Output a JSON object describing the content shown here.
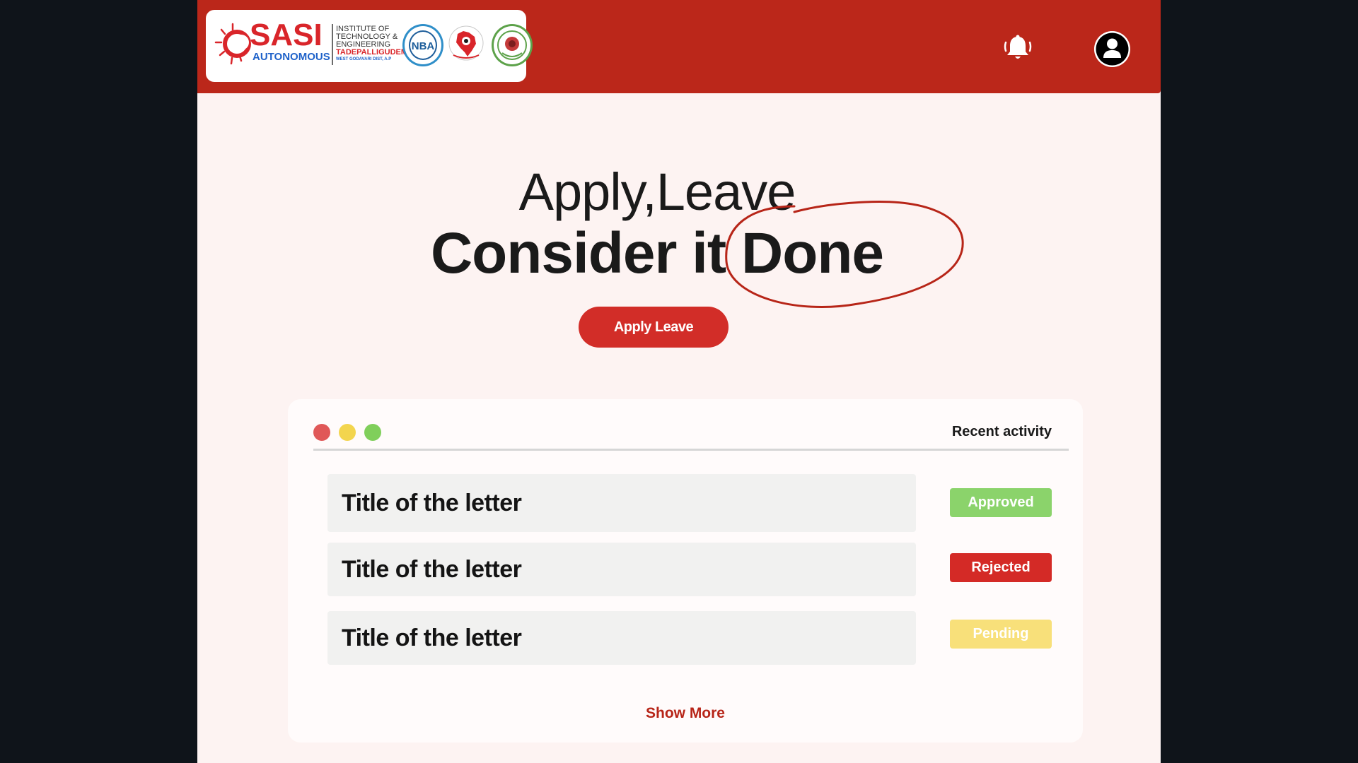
{
  "header": {
    "logo": {
      "name": "SASI",
      "subtitle": "AUTONOMOUS",
      "institute_lines": [
        "INSTITUTE OF",
        "TECHNOLOGY &",
        "ENGINEERING"
      ],
      "location": "TADEPALLIGUDEM",
      "district": "WEST GODAVARI DIST, A.P",
      "badge_nba": "NBA"
    },
    "icons": {
      "notifications": "bell-icon",
      "profile": "user-icon"
    }
  },
  "hero": {
    "line1": "Apply,Leave",
    "line2_prefix": "Consider it ",
    "line2_highlight": "Done",
    "cta_label": "Apply Leave"
  },
  "activity": {
    "title": "Recent activity",
    "window_dots": [
      "#e05858",
      "#f3d54e",
      "#80cf5b"
    ],
    "items": [
      {
        "title": "Title of the letter",
        "status": "Approved",
        "status_color": "#8bd36b"
      },
      {
        "title": "Title of the letter",
        "status": "Rejected",
        "status_color": "#d42a26"
      },
      {
        "title": "Title of the letter",
        "status": "Pending",
        "status_color": "#f8e07a"
      }
    ],
    "show_more_label": "Show More"
  },
  "colors": {
    "header_bg": "#bb271a",
    "page_bg": "#fdf3f2",
    "accent": "#d22d28",
    "outer_bg": "#0f141a"
  }
}
